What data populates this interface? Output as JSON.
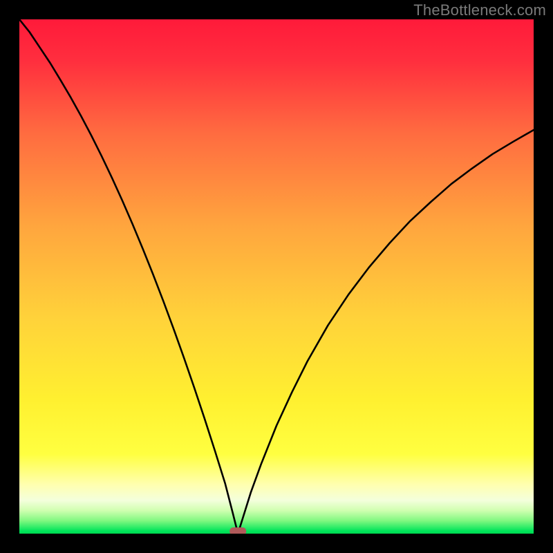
{
  "watermark": "TheBottleneck.com",
  "chart_data": {
    "type": "line",
    "title": "",
    "xlabel": "",
    "ylabel": "",
    "xlim": [
      0,
      100
    ],
    "ylim": [
      0,
      100
    ],
    "legend": false,
    "grid": false,
    "background_gradient": {
      "top_color": "#ff1a3a",
      "mid_color": "#ffd400",
      "bottom_accent": "#00e55a"
    },
    "min_marker": {
      "x": 42.5,
      "y": 0,
      "color": "#b05a5a"
    },
    "series": [
      {
        "name": "bottleneck-curve",
        "x": [
          0,
          2,
          4,
          6,
          8,
          10,
          12,
          14,
          16,
          18,
          20,
          22,
          24,
          26,
          28,
          30,
          32,
          34,
          36,
          38,
          40,
          41.5,
          42.5,
          45,
          47,
          50,
          53,
          56,
          60,
          64,
          68,
          72,
          76,
          80,
          84,
          88,
          92,
          96,
          100
        ],
        "y": [
          100,
          97.5,
          94.5,
          91.5,
          88.2,
          84.8,
          81.2,
          77.4,
          73.4,
          69.2,
          64.8,
          60.2,
          55.4,
          50.4,
          45.2,
          39.8,
          34.2,
          28.4,
          22.4,
          16.2,
          9.8,
          4.0,
          0.0,
          8.0,
          13.5,
          21.0,
          27.5,
          33.5,
          40.5,
          46.5,
          51.8,
          56.5,
          60.8,
          64.5,
          68.0,
          71.0,
          73.8,
          76.2,
          78.5
        ]
      }
    ]
  }
}
